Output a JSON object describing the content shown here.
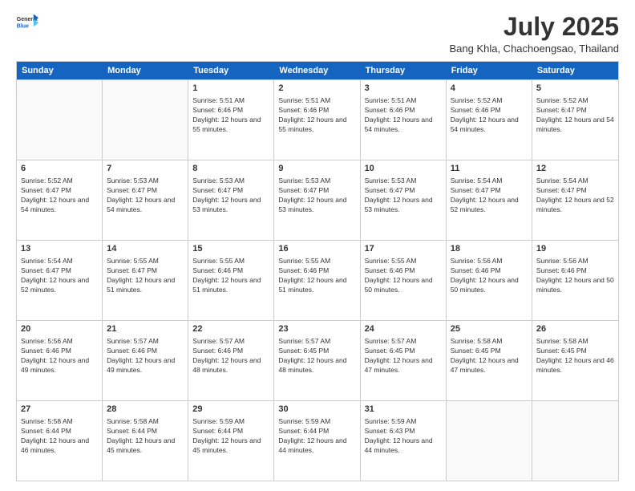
{
  "logo": {
    "general": "General",
    "blue": "Blue"
  },
  "title": {
    "month_year": "July 2025",
    "location": "Bang Khla, Chachoengsao, Thailand"
  },
  "calendar": {
    "headers": [
      "Sunday",
      "Monday",
      "Tuesday",
      "Wednesday",
      "Thursday",
      "Friday",
      "Saturday"
    ],
    "weeks": [
      [
        {
          "day": "",
          "info": ""
        },
        {
          "day": "",
          "info": ""
        },
        {
          "day": "1",
          "info": "Sunrise: 5:51 AM\nSunset: 6:46 PM\nDaylight: 12 hours and 55 minutes."
        },
        {
          "day": "2",
          "info": "Sunrise: 5:51 AM\nSunset: 6:46 PM\nDaylight: 12 hours and 55 minutes."
        },
        {
          "day": "3",
          "info": "Sunrise: 5:51 AM\nSunset: 6:46 PM\nDaylight: 12 hours and 54 minutes."
        },
        {
          "day": "4",
          "info": "Sunrise: 5:52 AM\nSunset: 6:46 PM\nDaylight: 12 hours and 54 minutes."
        },
        {
          "day": "5",
          "info": "Sunrise: 5:52 AM\nSunset: 6:47 PM\nDaylight: 12 hours and 54 minutes."
        }
      ],
      [
        {
          "day": "6",
          "info": "Sunrise: 5:52 AM\nSunset: 6:47 PM\nDaylight: 12 hours and 54 minutes."
        },
        {
          "day": "7",
          "info": "Sunrise: 5:53 AM\nSunset: 6:47 PM\nDaylight: 12 hours and 54 minutes."
        },
        {
          "day": "8",
          "info": "Sunrise: 5:53 AM\nSunset: 6:47 PM\nDaylight: 12 hours and 53 minutes."
        },
        {
          "day": "9",
          "info": "Sunrise: 5:53 AM\nSunset: 6:47 PM\nDaylight: 12 hours and 53 minutes."
        },
        {
          "day": "10",
          "info": "Sunrise: 5:53 AM\nSunset: 6:47 PM\nDaylight: 12 hours and 53 minutes."
        },
        {
          "day": "11",
          "info": "Sunrise: 5:54 AM\nSunset: 6:47 PM\nDaylight: 12 hours and 52 minutes."
        },
        {
          "day": "12",
          "info": "Sunrise: 5:54 AM\nSunset: 6:47 PM\nDaylight: 12 hours and 52 minutes."
        }
      ],
      [
        {
          "day": "13",
          "info": "Sunrise: 5:54 AM\nSunset: 6:47 PM\nDaylight: 12 hours and 52 minutes."
        },
        {
          "day": "14",
          "info": "Sunrise: 5:55 AM\nSunset: 6:47 PM\nDaylight: 12 hours and 51 minutes."
        },
        {
          "day": "15",
          "info": "Sunrise: 5:55 AM\nSunset: 6:46 PM\nDaylight: 12 hours and 51 minutes."
        },
        {
          "day": "16",
          "info": "Sunrise: 5:55 AM\nSunset: 6:46 PM\nDaylight: 12 hours and 51 minutes."
        },
        {
          "day": "17",
          "info": "Sunrise: 5:55 AM\nSunset: 6:46 PM\nDaylight: 12 hours and 50 minutes."
        },
        {
          "day": "18",
          "info": "Sunrise: 5:56 AM\nSunset: 6:46 PM\nDaylight: 12 hours and 50 minutes."
        },
        {
          "day": "19",
          "info": "Sunrise: 5:56 AM\nSunset: 6:46 PM\nDaylight: 12 hours and 50 minutes."
        }
      ],
      [
        {
          "day": "20",
          "info": "Sunrise: 5:56 AM\nSunset: 6:46 PM\nDaylight: 12 hours and 49 minutes."
        },
        {
          "day": "21",
          "info": "Sunrise: 5:57 AM\nSunset: 6:46 PM\nDaylight: 12 hours and 49 minutes."
        },
        {
          "day": "22",
          "info": "Sunrise: 5:57 AM\nSunset: 6:46 PM\nDaylight: 12 hours and 48 minutes."
        },
        {
          "day": "23",
          "info": "Sunrise: 5:57 AM\nSunset: 6:45 PM\nDaylight: 12 hours and 48 minutes."
        },
        {
          "day": "24",
          "info": "Sunrise: 5:57 AM\nSunset: 6:45 PM\nDaylight: 12 hours and 47 minutes."
        },
        {
          "day": "25",
          "info": "Sunrise: 5:58 AM\nSunset: 6:45 PM\nDaylight: 12 hours and 47 minutes."
        },
        {
          "day": "26",
          "info": "Sunrise: 5:58 AM\nSunset: 6:45 PM\nDaylight: 12 hours and 46 minutes."
        }
      ],
      [
        {
          "day": "27",
          "info": "Sunrise: 5:58 AM\nSunset: 6:44 PM\nDaylight: 12 hours and 46 minutes."
        },
        {
          "day": "28",
          "info": "Sunrise: 5:58 AM\nSunset: 6:44 PM\nDaylight: 12 hours and 45 minutes."
        },
        {
          "day": "29",
          "info": "Sunrise: 5:59 AM\nSunset: 6:44 PM\nDaylight: 12 hours and 45 minutes."
        },
        {
          "day": "30",
          "info": "Sunrise: 5:59 AM\nSunset: 6:44 PM\nDaylight: 12 hours and 44 minutes."
        },
        {
          "day": "31",
          "info": "Sunrise: 5:59 AM\nSunset: 6:43 PM\nDaylight: 12 hours and 44 minutes."
        },
        {
          "day": "",
          "info": ""
        },
        {
          "day": "",
          "info": ""
        }
      ]
    ]
  }
}
